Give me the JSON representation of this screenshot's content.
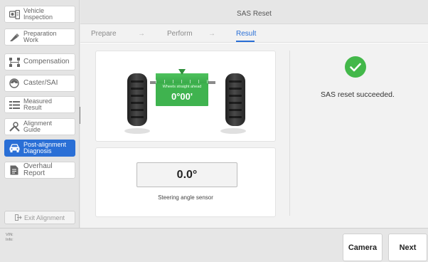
{
  "window": {
    "title": "SAS Reset"
  },
  "sidebar": {
    "items": [
      {
        "label_l1": "Vehicle",
        "label_l2": "Inspection",
        "icon": "vehicle-inspection-icon",
        "active": false
      },
      {
        "label_l1": "Preparation",
        "label_l2": "Work",
        "icon": "preparation-icon",
        "active": false
      },
      {
        "label_l1": "Compensation",
        "label_l2": "",
        "icon": "compensation-icon",
        "active": false
      },
      {
        "label_l1": "Caster/SAI",
        "label_l2": "",
        "icon": "caster-icon",
        "active": false
      },
      {
        "label_l1": "Measured",
        "label_l2": "Result",
        "icon": "measured-result-icon",
        "active": false
      },
      {
        "label_l1": "Alignment",
        "label_l2": "Guide",
        "icon": "alignment-guide-icon",
        "active": false
      },
      {
        "label_l1": "Post-alignment",
        "label_l2": "Diagnosis",
        "icon": "car-icon",
        "active": true
      },
      {
        "label_l1": "Overhaul Report",
        "label_l2": "",
        "icon": "report-icon",
        "active": false
      }
    ],
    "exit_label": "Exit Alignment"
  },
  "steps": {
    "prepare": "Prepare",
    "perform": "Perform",
    "result": "Result",
    "arrow": "→",
    "active": "Result"
  },
  "wheel_display": {
    "caption": "Wheels straight ahead",
    "angle": "0°00'"
  },
  "sensor": {
    "value": "0.0°",
    "label": "Steering angle sensor"
  },
  "result": {
    "message": "SAS reset succeeded.",
    "status": "success"
  },
  "footer": {
    "vin_label": "VIN:",
    "info_label": "Info:",
    "camera_label": "Camera",
    "next_label": "Next"
  },
  "colors": {
    "accent": "#2a6fd6",
    "success": "#43b84a",
    "panel_green": "#3fb34f"
  }
}
